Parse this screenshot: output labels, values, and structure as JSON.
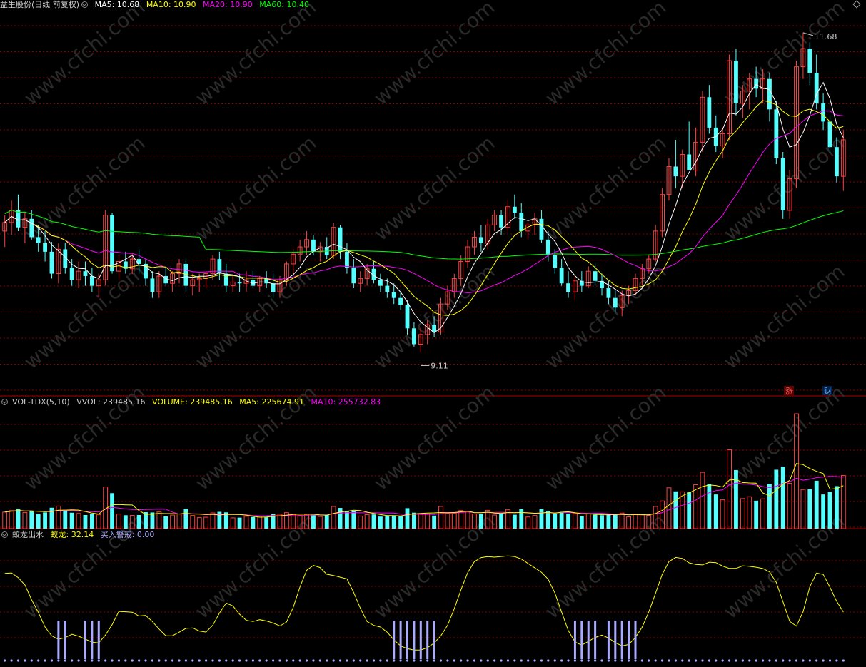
{
  "main_panel": {
    "title": "益生股份(日线 前复权)",
    "indicators": [
      {
        "label": "MA5: 10.68",
        "color": "#ffffff"
      },
      {
        "label": "MA10: 10.90",
        "color": "#ffff00"
      },
      {
        "label": "MA20: 10.90",
        "color": "#ff00ff"
      },
      {
        "label": "MA60: 10.40",
        "color": "#00ff00"
      }
    ],
    "high_label": "11.68",
    "low_label": "9.11",
    "marker_up": "涨",
    "marker_cai": "财"
  },
  "volume_panel": {
    "title": "VOL-TDX(5,10)",
    "indicators": [
      {
        "label": "VVOL: 239485.16",
        "color": "#cccccc"
      },
      {
        "label": "VOLUME: 239485.16",
        "color": "#ffff00"
      },
      {
        "label": "MA5: 225674.91",
        "color": "#ffff00"
      },
      {
        "label": "MA10: 255732.83",
        "color": "#ff00ff"
      }
    ]
  },
  "signal_panel": {
    "title": "蛟龙出水",
    "indicators": [
      {
        "label": "蛟龙: 32.14",
        "color": "#ffff00"
      },
      {
        "label": "买入警戒: 0.00",
        "color": "#aaaaff"
      }
    ]
  },
  "watermark": "www.cfchi.com",
  "colors": {
    "up": "#ff4040",
    "down": "#54ffff",
    "grid": "#8b0000",
    "ma5": "#ffffff",
    "ma10": "#ffff00",
    "ma20": "#ff00ff",
    "ma60": "#00ff00",
    "signal": "#ffff00",
    "alert": "#aaaaff"
  },
  "chart_data": {
    "type": "candlestick",
    "price_range": [
      8.9,
      11.82
    ],
    "candles": [
      [
        10.05,
        10.18,
        9.92,
        10.12
      ],
      [
        10.12,
        10.3,
        10.02,
        10.22
      ],
      [
        10.22,
        10.35,
        10.05,
        10.08
      ],
      [
        10.08,
        10.2,
        9.95,
        10.15
      ],
      [
        10.15,
        10.22,
        9.98,
        10.0
      ],
      [
        10.0,
        10.1,
        9.88,
        9.95
      ],
      [
        9.95,
        10.05,
        9.8,
        9.88
      ],
      [
        9.88,
        9.96,
        9.66,
        9.7
      ],
      [
        9.7,
        9.95,
        9.62,
        9.9
      ],
      [
        9.9,
        9.95,
        9.7,
        9.75
      ],
      [
        9.75,
        9.82,
        9.6,
        9.65
      ],
      [
        9.65,
        9.8,
        9.58,
        9.72
      ],
      [
        9.72,
        9.8,
        9.6,
        9.68
      ],
      [
        9.68,
        9.75,
        9.55,
        9.6
      ],
      [
        9.6,
        9.7,
        9.5,
        9.65
      ],
      [
        9.65,
        10.22,
        9.6,
        10.18
      ],
      [
        10.18,
        10.2,
        9.7,
        9.72
      ],
      [
        9.72,
        9.85,
        9.65,
        9.8
      ],
      [
        9.8,
        9.88,
        9.7,
        9.74
      ],
      [
        9.74,
        9.86,
        9.7,
        9.82
      ],
      [
        9.82,
        9.9,
        9.7,
        9.78
      ],
      [
        9.78,
        9.82,
        9.6,
        9.66
      ],
      [
        9.66,
        9.72,
        9.5,
        9.55
      ],
      [
        9.55,
        9.72,
        9.5,
        9.68
      ],
      [
        9.68,
        9.75,
        9.6,
        9.62
      ],
      [
        9.62,
        9.72,
        9.55,
        9.7
      ],
      [
        9.7,
        9.82,
        9.62,
        9.78
      ],
      [
        9.78,
        9.82,
        9.55,
        9.6
      ],
      [
        9.6,
        9.7,
        9.52,
        9.65
      ],
      [
        9.65,
        9.7,
        9.55,
        9.66
      ],
      [
        9.66,
        9.72,
        9.58,
        9.7
      ],
      [
        9.7,
        9.85,
        9.65,
        9.82
      ],
      [
        9.82,
        9.88,
        9.65,
        9.7
      ],
      [
        9.7,
        9.78,
        9.55,
        9.6
      ],
      [
        9.6,
        9.68,
        9.55,
        9.63
      ],
      [
        9.63,
        9.7,
        9.55,
        9.62
      ],
      [
        9.62,
        9.72,
        9.55,
        9.65
      ],
      [
        9.65,
        9.72,
        9.58,
        9.6
      ],
      [
        9.6,
        9.68,
        9.55,
        9.66
      ],
      [
        9.66,
        9.72,
        9.58,
        9.62
      ],
      [
        9.62,
        9.7,
        9.5,
        9.55
      ],
      [
        9.55,
        9.68,
        9.5,
        9.65
      ],
      [
        9.65,
        9.8,
        9.6,
        9.78
      ],
      [
        9.78,
        9.9,
        9.7,
        9.86
      ],
      [
        9.86,
        9.98,
        9.8,
        9.92
      ],
      [
        9.92,
        10.05,
        9.85,
        9.98
      ],
      [
        9.98,
        10.02,
        9.85,
        9.88
      ],
      [
        9.88,
        9.96,
        9.8,
        9.92
      ],
      [
        9.92,
        10.0,
        9.82,
        9.85
      ],
      [
        9.85,
        10.12,
        9.82,
        10.08
      ],
      [
        10.08,
        10.1,
        9.82,
        9.88
      ],
      [
        9.88,
        9.95,
        9.7,
        9.75
      ],
      [
        9.75,
        9.82,
        9.58,
        9.62
      ],
      [
        9.62,
        9.72,
        9.55,
        9.66
      ],
      [
        9.66,
        9.78,
        9.6,
        9.74
      ],
      [
        9.74,
        9.8,
        9.62,
        9.65
      ],
      [
        9.65,
        9.7,
        9.55,
        9.6
      ],
      [
        9.6,
        9.66,
        9.5,
        9.55
      ],
      [
        9.55,
        9.62,
        9.45,
        9.5
      ],
      [
        9.5,
        9.55,
        9.4,
        9.44
      ],
      [
        9.44,
        9.48,
        9.2,
        9.25
      ],
      [
        9.25,
        9.3,
        9.1,
        9.12
      ],
      [
        9.12,
        9.25,
        9.05,
        9.2
      ],
      [
        9.2,
        9.32,
        9.12,
        9.28
      ],
      [
        9.28,
        9.35,
        9.18,
        9.22
      ],
      [
        9.22,
        9.5,
        9.2,
        9.45
      ],
      [
        9.45,
        9.6,
        9.4,
        9.55
      ],
      [
        9.55,
        9.7,
        9.5,
        9.66
      ],
      [
        9.66,
        9.85,
        9.6,
        9.8
      ],
      [
        9.8,
        9.98,
        9.75,
        9.92
      ],
      [
        9.92,
        10.05,
        9.85,
        10.0
      ],
      [
        10.0,
        10.1,
        9.88,
        9.95
      ],
      [
        9.95,
        10.15,
        9.9,
        10.1
      ],
      [
        10.1,
        10.22,
        10.05,
        10.18
      ],
      [
        10.18,
        10.22,
        10.02,
        10.08
      ],
      [
        10.08,
        10.3,
        10.05,
        10.25
      ],
      [
        10.25,
        10.35,
        10.15,
        10.2
      ],
      [
        10.2,
        10.28,
        10.0,
        10.05
      ],
      [
        10.05,
        10.12,
        9.98,
        10.1
      ],
      [
        10.1,
        10.2,
        10.02,
        10.15
      ],
      [
        10.15,
        10.22,
        9.95,
        9.98
      ],
      [
        9.98,
        10.05,
        9.8,
        9.85
      ],
      [
        9.85,
        9.9,
        9.7,
        9.75
      ],
      [
        9.75,
        9.82,
        9.6,
        9.62
      ],
      [
        9.62,
        9.72,
        9.5,
        9.55
      ],
      [
        9.55,
        9.68,
        9.48,
        9.64
      ],
      [
        9.64,
        9.72,
        9.55,
        9.6
      ],
      [
        9.6,
        9.76,
        9.58,
        9.72
      ],
      [
        9.72,
        9.78,
        9.6,
        9.64
      ],
      [
        9.64,
        9.7,
        9.52,
        9.58
      ],
      [
        9.58,
        9.64,
        9.45,
        9.5
      ],
      [
        9.5,
        9.56,
        9.38,
        9.42
      ],
      [
        9.42,
        9.56,
        9.35,
        9.52
      ],
      [
        9.52,
        9.6,
        9.45,
        9.56
      ],
      [
        9.56,
        9.7,
        9.52,
        9.66
      ],
      [
        9.66,
        9.78,
        9.6,
        9.74
      ],
      [
        9.74,
        9.86,
        9.7,
        9.82
      ],
      [
        9.82,
        10.1,
        9.8,
        10.05
      ],
      [
        10.05,
        10.4,
        10.0,
        10.35
      ],
      [
        10.35,
        10.65,
        10.3,
        10.58
      ],
      [
        10.58,
        10.8,
        10.4,
        10.5
      ],
      [
        10.5,
        10.72,
        10.4,
        10.68
      ],
      [
        10.68,
        10.95,
        10.6,
        10.55
      ],
      [
        10.55,
        10.9,
        10.5,
        10.78
      ],
      [
        10.78,
        11.2,
        10.7,
        11.15
      ],
      [
        11.15,
        11.25,
        10.85,
        10.9
      ],
      [
        10.9,
        11.0,
        10.7,
        10.75
      ],
      [
        10.75,
        10.9,
        10.65,
        10.85
      ],
      [
        10.85,
        11.5,
        10.8,
        11.45
      ],
      [
        11.45,
        11.55,
        11.0,
        11.1
      ],
      [
        11.1,
        11.25,
        10.98,
        11.2
      ],
      [
        11.2,
        11.35,
        11.05,
        11.3
      ],
      [
        11.3,
        11.4,
        11.15,
        11.22
      ],
      [
        11.22,
        11.38,
        11.1,
        11.3
      ],
      [
        11.3,
        11.35,
        10.95,
        11.05
      ],
      [
        11.05,
        11.12,
        10.6,
        10.65
      ],
      [
        10.65,
        10.7,
        10.15,
        10.22
      ],
      [
        10.22,
        10.55,
        10.15,
        10.48
      ],
      [
        10.48,
        11.45,
        10.4,
        11.4
      ],
      [
        11.4,
        11.68,
        11.3,
        11.55
      ],
      [
        11.55,
        11.6,
        11.25,
        11.35
      ],
      [
        11.35,
        11.5,
        11.05,
        11.1
      ],
      [
        11.1,
        11.18,
        10.88,
        10.95
      ],
      [
        10.95,
        11.0,
        10.7,
        10.74
      ],
      [
        10.74,
        10.82,
        10.45,
        10.5
      ],
      [
        10.5,
        10.88,
        10.38,
        10.8
      ]
    ],
    "ma5_last": 10.68,
    "ma10_last": 10.9,
    "ma20_last": 10.9,
    "ma60_last": 10.4,
    "volume_last": 239485.16,
    "volume_ma5_last": 225674.91,
    "volume_ma10_last": 255732.83,
    "signal_last": 32.14,
    "alert_last": 0.0
  }
}
